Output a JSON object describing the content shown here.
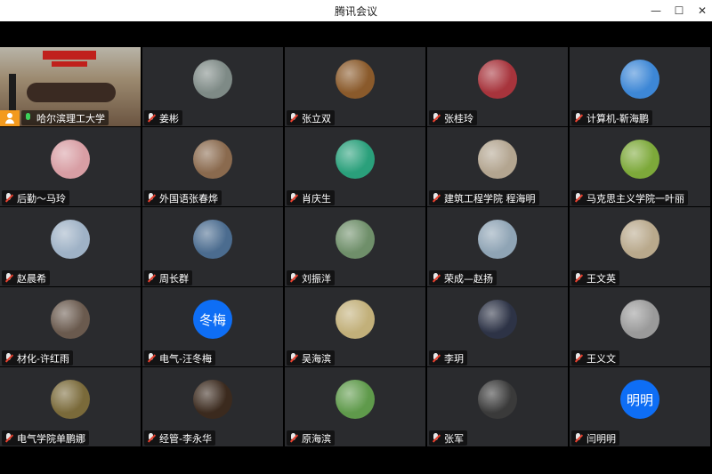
{
  "window": {
    "title": "腾讯会议",
    "min_glyph": "—",
    "max_glyph": "☐",
    "close_glyph": "✕"
  },
  "participants": [
    {
      "name": "哈尔滨理工大学",
      "video": true,
      "host": true,
      "mic": "on"
    },
    {
      "name": "姜彬",
      "avatar": "photo",
      "color": "#7e8a86"
    },
    {
      "name": "张立双",
      "avatar": "photo",
      "color": "#8a5a2b"
    },
    {
      "name": "张桂玲",
      "avatar": "photo",
      "color": "#a7343c"
    },
    {
      "name": "计算机-靳海鹏",
      "avatar": "photo",
      "color": "#3d87d6"
    },
    {
      "name": "后勤～马玲",
      "avatar": "photo",
      "color": "#d89ea4"
    },
    {
      "name": "外国语张春烨",
      "avatar": "photo",
      "color": "#8a6a4e"
    },
    {
      "name": "肖庆生",
      "avatar": "photo",
      "color": "#2aa07b"
    },
    {
      "name": "建筑工程学院 程海明",
      "avatar": "photo",
      "color": "#b3a590"
    },
    {
      "name": "马克思主义学院一叶丽",
      "avatar": "photo",
      "color": "#7da93a"
    },
    {
      "name": "赵晨希",
      "avatar": "photo",
      "color": "#9fb2c6"
    },
    {
      "name": "周长群",
      "avatar": "photo",
      "color": "#4b6c8f"
    },
    {
      "name": "刘振洋",
      "avatar": "photo",
      "color": "#6f8f6a"
    },
    {
      "name": "荣成—赵扬",
      "avatar": "photo",
      "color": "#8fa4b5"
    },
    {
      "name": "王文英",
      "avatar": "photo",
      "color": "#b9a98c"
    },
    {
      "name": "材化-许红雨",
      "avatar": "photo",
      "color": "#6a5a4e"
    },
    {
      "name": "电气-汪冬梅",
      "avatar": "text",
      "initials": "冬梅",
      "color": "#0e6ef5"
    },
    {
      "name": "吴海滨",
      "avatar": "photo",
      "color": "#c2b07a"
    },
    {
      "name": "李玥",
      "avatar": "photo",
      "color": "#2d3346"
    },
    {
      "name": "王义文",
      "avatar": "photo",
      "color": "#9a9a9a"
    },
    {
      "name": "电气学院单鹏娜",
      "avatar": "photo",
      "color": "#7a6a3a"
    },
    {
      "name": "经管-李永华",
      "avatar": "photo",
      "color": "#3b2a1e"
    },
    {
      "name": "原海滨",
      "avatar": "photo",
      "color": "#5f9a4b"
    },
    {
      "name": "张军",
      "avatar": "photo",
      "color": "#3a3a3a"
    },
    {
      "name": "闫明明",
      "avatar": "text",
      "initials": "明明",
      "color": "#0e6ef5"
    }
  ]
}
